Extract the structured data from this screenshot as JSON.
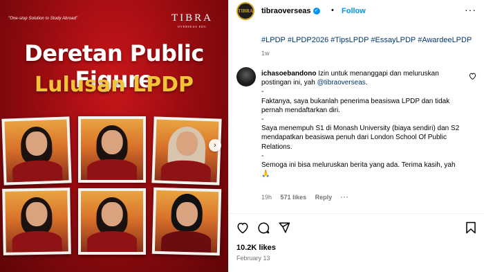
{
  "image": {
    "tagline": "\"One-stop Solution to Study Abroad\"",
    "brand": "TIBRA",
    "brand_sub": "OVERSEAS EDU",
    "title_line1": "Deretan Public Figure",
    "title_line2": "Lulusan LPDP",
    "next_icon": "chevron-right-icon"
  },
  "header": {
    "username": "tibraoverseas",
    "separator": "•",
    "follow_label": "Follow",
    "more_label": "···",
    "avatar_text": "TIBRA"
  },
  "caption": {
    "hashtags": [
      "#LPDP",
      "#LPDP2026",
      "#TipsLPDP",
      "#EssayLPDP",
      "#AwardeeLPDP"
    ],
    "time": "1w"
  },
  "comment": {
    "username": "ichasoebandono",
    "line1": "Izin untuk menanggapi dan meluruskan postingan ini, yah",
    "mention": "@tibraoverseas",
    "line1_end": ".",
    "dash1": "-",
    "para1": "Faktanya, saya bukanlah penerima beasiswa LPDP dan tidak pernah mendaftarkan diri.",
    "dash2": "-",
    "para2": "Saya menempuh S1 di Monash University (biaya sendiri) dan S2 mendapatkan beasiswa penuh dari London School Of Public Relations.",
    "dash3": "-",
    "para3": "Semoga ini bisa meluruskan berita yang ada. Terima kasih, yah",
    "emoji": "🙏",
    "time": "19h",
    "likes": "571 likes",
    "reply_label": "Reply",
    "more_label": "···"
  },
  "post": {
    "likes": "10.2K likes",
    "date": "February 13"
  },
  "colors": {
    "accent": "#0095f6",
    "link": "#00376b",
    "muted": "#737373",
    "gold": "#f2c33a",
    "red": "#9a0c10"
  }
}
